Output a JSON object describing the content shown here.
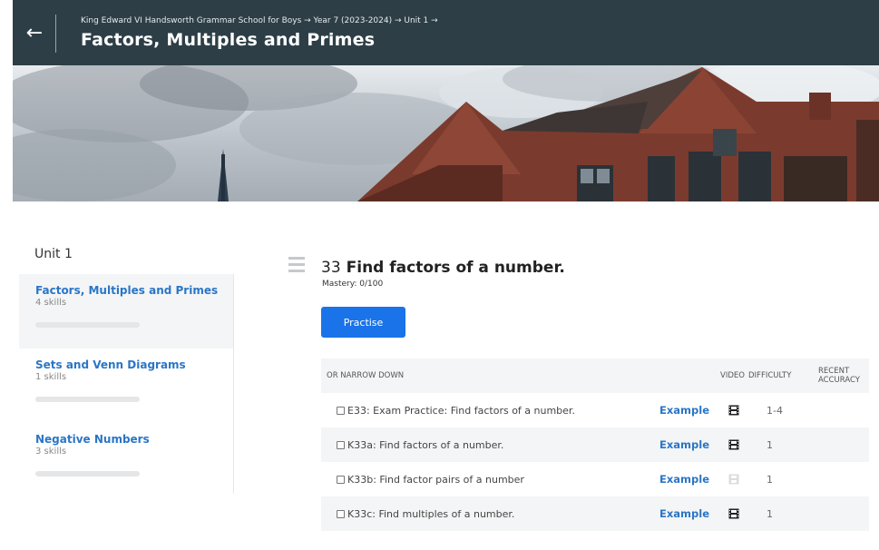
{
  "header": {
    "breadcrumb": "King Edward VI Handsworth Grammar School for Boys → Year 7 (2023-2024) → Unit 1 →",
    "title": "Factors, Multiples and Primes",
    "back_icon": "←"
  },
  "sidebar": {
    "title": "Unit 1",
    "items": [
      {
        "name": "Factors, Multiples and Primes",
        "count": "4 skills",
        "progress": 0
      },
      {
        "name": "Sets and Venn Diagrams",
        "count": "1 skills",
        "progress": 0
      },
      {
        "name": "Negative Numbers",
        "count": "3 skills",
        "progress": 0
      }
    ]
  },
  "skill": {
    "number": "33",
    "name": "Find factors of a number.",
    "mastery": "Mastery: 0/100",
    "practise_label": "Practise"
  },
  "table": {
    "headers": {
      "narrow": "OR NARROW DOWN",
      "video": "VIDEO",
      "difficulty": "DIFFICULTY",
      "accuracy_line1": "RECENT",
      "accuracy_line2": "ACCURACY"
    },
    "rows": [
      {
        "label": "E33: Exam Practice: Find factors of a number.",
        "example": "Example",
        "video": "film-icon",
        "video_available": true,
        "difficulty": "1-4",
        "accuracy": ""
      },
      {
        "label": "K33a: Find factors of a number.",
        "example": "Example",
        "video": "film-icon",
        "video_available": true,
        "difficulty": "1",
        "accuracy": ""
      },
      {
        "label": "K33b: Find factor pairs of a number",
        "example": "Example",
        "video": "film-icon",
        "video_available": false,
        "difficulty": "1",
        "accuracy": ""
      },
      {
        "label": "K33c: Find multiples of a number.",
        "example": "Example",
        "video": "film-icon",
        "video_available": true,
        "difficulty": "1",
        "accuracy": ""
      }
    ]
  },
  "colors": {
    "header_bg": "#2d3e46",
    "accent": "#2a76c6",
    "button": "#1a73e8",
    "row_alt": "#f4f5f6"
  }
}
